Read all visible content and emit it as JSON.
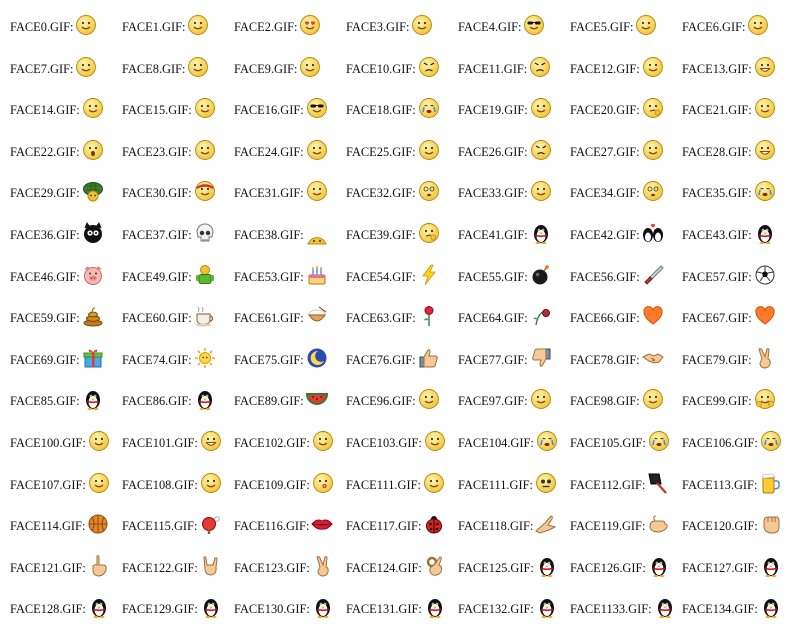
{
  "items": [
    {
      "label": "FACE0.GIF:",
      "icon": "smiley-face-icon"
    },
    {
      "label": "FACE1.GIF:",
      "icon": "smiley-face-icon"
    },
    {
      "label": "FACE2.GIF:",
      "icon": "heart-eyes-face-icon"
    },
    {
      "label": "FACE3.GIF:",
      "icon": "smiley-face-icon"
    },
    {
      "label": "FACE4.GIF:",
      "icon": "sunglasses-face-icon"
    },
    {
      "label": "FACE5.GIF:",
      "icon": "smiley-face-icon"
    },
    {
      "label": "FACE6.GIF:",
      "icon": "smiley-face-icon"
    },
    {
      "label": "FACE7.GIF:",
      "icon": "smiley-face-icon"
    },
    {
      "label": "FACE8.GIF:",
      "icon": "smiley-face-icon"
    },
    {
      "label": "FACE9.GIF:",
      "icon": "smiley-face-icon"
    },
    {
      "label": "FACE10.GIF:",
      "icon": "angry-red-face-icon"
    },
    {
      "label": "FACE11.GIF:",
      "icon": "angry-red-face-icon"
    },
    {
      "label": "FACE12.GIF:",
      "icon": "smiley-face-icon"
    },
    {
      "label": "FACE13.GIF:",
      "icon": "grin-face-icon"
    },
    {
      "label": "FACE14.GIF:",
      "icon": "smiley-face-icon"
    },
    {
      "label": "FACE15.GIF:",
      "icon": "smiley-face-icon"
    },
    {
      "label": "FACE16.GIF:",
      "icon": "sunglasses-face-icon"
    },
    {
      "label": "FACE18.GIF:",
      "icon": "crying-face-icon"
    },
    {
      "label": "FACE19.GIF:",
      "icon": "smiley-face-icon"
    },
    {
      "label": "FACE20.GIF:",
      "icon": "thinking-face-icon"
    },
    {
      "label": "FACE21.GIF:",
      "icon": "smiley-face-icon"
    },
    {
      "label": "FACE22.GIF:",
      "icon": "surprised-face-icon"
    },
    {
      "label": "FACE23.GIF:",
      "icon": "smiley-face-icon"
    },
    {
      "label": "FACE24.GIF:",
      "icon": "smiley-face-icon"
    },
    {
      "label": "FACE25.GIF:",
      "icon": "smiley-face-icon"
    },
    {
      "label": "FACE26.GIF:",
      "icon": "angry-red-face-icon"
    },
    {
      "label": "FACE27.GIF:",
      "icon": "smiley-face-icon"
    },
    {
      "label": "FACE28.GIF:",
      "icon": "grin-face-icon"
    },
    {
      "label": "FACE29.GIF:",
      "icon": "turtle-face-icon"
    },
    {
      "label": "FACE30.GIF:",
      "icon": "bandana-face-icon"
    },
    {
      "label": "FACE31.GIF:",
      "icon": "smiley-face-icon"
    },
    {
      "label": "FACE32.GIF:",
      "icon": "dizzy-face-icon"
    },
    {
      "label": "FACE33.GIF:",
      "icon": "smiley-face-icon"
    },
    {
      "label": "FACE34.GIF:",
      "icon": "dizzy-face-icon"
    },
    {
      "label": "FACE35.GIF:",
      "icon": "crying-face-icon"
    },
    {
      "label": "FACE36.GIF:",
      "icon": "black-creature-icon"
    },
    {
      "label": "FACE37.GIF:",
      "icon": "skull-icon"
    },
    {
      "label": "FACE38.GIF:",
      "icon": "peeking-face-icon"
    },
    {
      "label": "FACE39.GIF:",
      "icon": "thinking-face-icon"
    },
    {
      "label": "FACE41.GIF:",
      "icon": "penguin-icon"
    },
    {
      "label": "FACE42.GIF:",
      "icon": "penguin-couple-icon"
    },
    {
      "label": "FACE43.GIF:",
      "icon": "penguin-icon"
    },
    {
      "label": "FACE46.GIF:",
      "icon": "pig-icon"
    },
    {
      "label": "FACE49.GIF:",
      "icon": "green-figure-icon"
    },
    {
      "label": "FACE53.GIF:",
      "icon": "birthday-cake-icon"
    },
    {
      "label": "FACE54.GIF:",
      "icon": "lightning-icon"
    },
    {
      "label": "FACE55.GIF:",
      "icon": "bomb-icon"
    },
    {
      "label": "FACE56.GIF:",
      "icon": "knife-icon"
    },
    {
      "label": "FACE57.GIF:",
      "icon": "soccer-ball-icon"
    },
    {
      "label": "FACE59.GIF:",
      "icon": "poop-icon"
    },
    {
      "label": "FACE60.GIF:",
      "icon": "coffee-icon"
    },
    {
      "label": "FACE61.GIF:",
      "icon": "rice-bowl-icon"
    },
    {
      "label": "FACE63.GIF:",
      "icon": "rose-icon"
    },
    {
      "label": "FACE64.GIF:",
      "icon": "wilted-rose-icon"
    },
    {
      "label": "FACE66.GIF:",
      "icon": "heart-icon"
    },
    {
      "label": "FACE67.GIF:",
      "icon": "heart-icon"
    },
    {
      "label": "FACE69.GIF:",
      "icon": "gift-icon"
    },
    {
      "label": "FACE74.GIF:",
      "icon": "sun-icon"
    },
    {
      "label": "FACE75.GIF:",
      "icon": "moon-icon"
    },
    {
      "label": "FACE76.GIF:",
      "icon": "thumbs-up-icon"
    },
    {
      "label": "FACE77.GIF:",
      "icon": "thumbs-down-icon"
    },
    {
      "label": "FACE78.GIF:",
      "icon": "handshake-icon"
    },
    {
      "label": "FACE79.GIF:",
      "icon": "victory-hand-icon"
    },
    {
      "label": "FACE85.GIF:",
      "icon": "penguin-icon"
    },
    {
      "label": "FACE86.GIF:",
      "icon": "penguin-icon"
    },
    {
      "label": "FACE89.GIF:",
      "icon": "watermelon-icon"
    },
    {
      "label": "FACE96.GIF:",
      "icon": "smiley-face-icon"
    },
    {
      "label": "FACE97.GIF:",
      "icon": "smiley-face-icon"
    },
    {
      "label": "FACE98.GIF:",
      "icon": "smiley-face-icon"
    },
    {
      "label": "FACE99.GIF:",
      "icon": "clapping-face-icon"
    },
    {
      "label": "FACE100.GIF:",
      "icon": "smiley-face-icon"
    },
    {
      "label": "FACE101.GIF:",
      "icon": "grin-face-icon"
    },
    {
      "label": "FACE102.GIF:",
      "icon": "smiley-face-icon"
    },
    {
      "label": "FACE103.GIF:",
      "icon": "smiley-face-icon"
    },
    {
      "label": "FACE104.GIF:",
      "icon": "crying-face-icon"
    },
    {
      "label": "FACE105.GIF:",
      "icon": "crying-face-icon"
    },
    {
      "label": "FACE106.GIF:",
      "icon": "crying-face-icon"
    },
    {
      "label": "FACE107.GIF:",
      "icon": "smiley-face-icon"
    },
    {
      "label": "FACE108.GIF:",
      "icon": "smiley-face-icon"
    },
    {
      "label": "FACE109.GIF:",
      "icon": "kissing-face-icon"
    },
    {
      "label": "FACE111.GIF:",
      "icon": "smiley-face-icon"
    },
    {
      "label": "FACE111.GIF:",
      "icon": "skull-face-icon"
    },
    {
      "label": "FACE112.GIF:",
      "icon": "cleaver-icon"
    },
    {
      "label": "FACE113.GIF:",
      "icon": "beer-mug-icon"
    },
    {
      "label": "FACE114.GIF:",
      "icon": "basketball-icon"
    },
    {
      "label": "FACE115.GIF:",
      "icon": "ping-pong-icon"
    },
    {
      "label": "FACE116.GIF:",
      "icon": "lips-icon"
    },
    {
      "label": "FACE117.GIF:",
      "icon": "ladybug-icon"
    },
    {
      "label": "FACE118.GIF:",
      "icon": "clasped-hands-icon"
    },
    {
      "label": "FACE119.GIF:",
      "icon": "beckoning-hand-icon"
    },
    {
      "label": "FACE120.GIF:",
      "icon": "fist-icon"
    },
    {
      "label": "FACE121.GIF:",
      "icon": "pointing-hand-icon"
    },
    {
      "label": "FACE122.GIF:",
      "icon": "rock-hand-icon"
    },
    {
      "label": "FACE123.GIF:",
      "icon": "victory-hand-icon"
    },
    {
      "label": "FACE124.GIF:",
      "icon": "ok-hand-icon"
    },
    {
      "label": "FACE125.GIF:",
      "icon": "penguin-icon"
    },
    {
      "label": "FACE126.GIF:",
      "icon": "penguin-icon"
    },
    {
      "label": "FACE127.GIF:",
      "icon": "penguin-icon"
    },
    {
      "label": "FACE128.GIF:",
      "icon": "penguin-icon"
    },
    {
      "label": "FACE129.GIF:",
      "icon": "penguin-icon"
    },
    {
      "label": "FACE130.GIF:",
      "icon": "penguin-icon"
    },
    {
      "label": "FACE131.GIF:",
      "icon": "penguin-icon"
    },
    {
      "label": "FACE132.GIF:",
      "icon": "penguin-icon"
    },
    {
      "label": "FACE1133.GIF:",
      "icon": "penguin-icon"
    },
    {
      "label": "FACE134.GIF:",
      "icon": "penguin-icon"
    }
  ]
}
